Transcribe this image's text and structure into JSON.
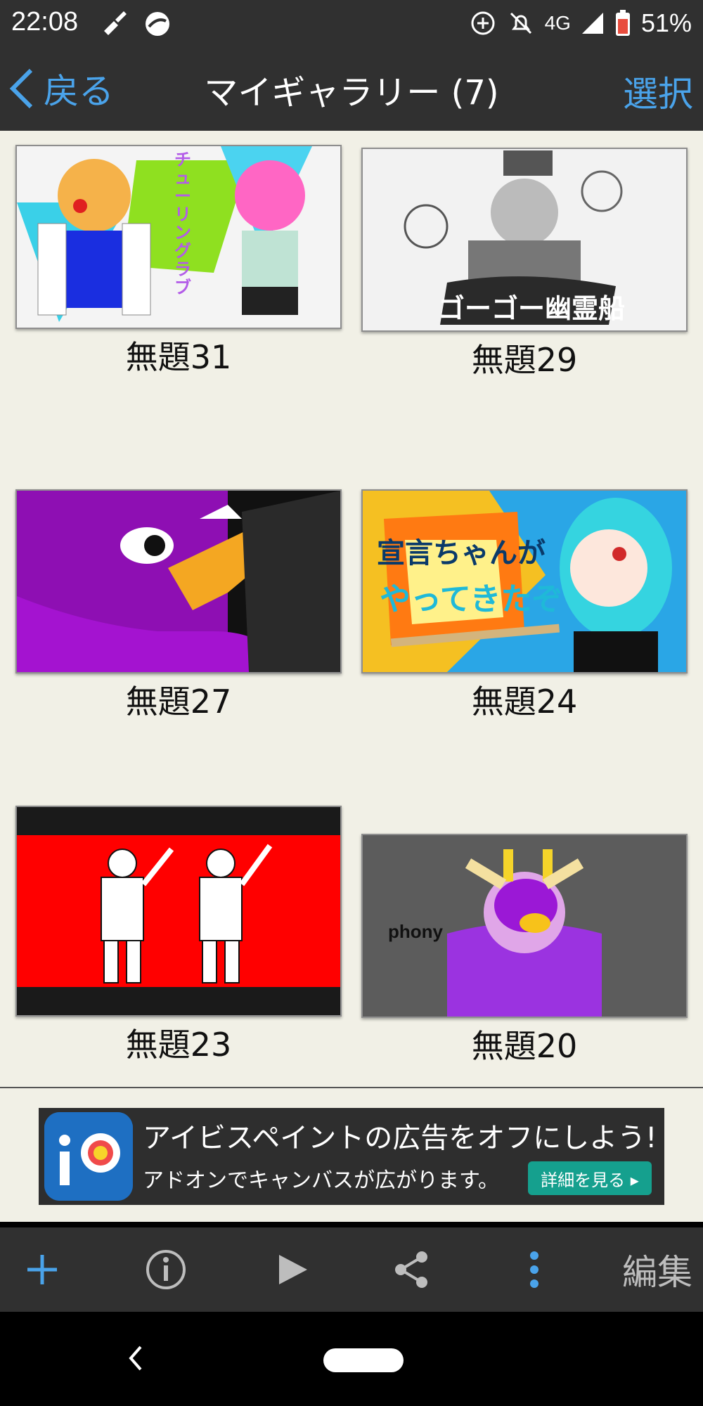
{
  "status_bar": {
    "time": "22:08",
    "network": "4G",
    "battery": "51%",
    "icons": [
      "broom-icon",
      "round-app-icon",
      "data-saver-icon",
      "bell-off-icon",
      "signal-icon",
      "battery-icon"
    ]
  },
  "app_bar": {
    "back_label": "戻る",
    "title": "マイギャラリー (7)",
    "select_label": "選択"
  },
  "gallery": {
    "items": [
      {
        "title": "無題31"
      },
      {
        "title": "無題29"
      },
      {
        "title": "無題27"
      },
      {
        "title": "無題24"
      },
      {
        "title": "無題23"
      },
      {
        "title": "無題20"
      }
    ]
  },
  "artwork_text": {
    "thumb1_vertical": "チューリングラブ",
    "thumb2_banner": "ゴーゴー幽霊船",
    "thumb4_line1": "宣言ちゃんが",
    "thumb4_line2": "やってきたぞ",
    "thumb6_word": "phony"
  },
  "ad": {
    "line1": "アイビスペイントの広告をオフにしよう!",
    "line2": "アドオンでキャンバスが広がります。",
    "button": "詳細を見る ▸"
  },
  "toolbar": {
    "edit_label": "編集",
    "accent": "#4aa3ea",
    "icons": [
      "plus-icon",
      "info-icon",
      "play-icon",
      "share-icon",
      "more-vertical-icon"
    ]
  },
  "colors": {
    "bar": "#303030",
    "background": "#f1f0e6",
    "accent": "#4aa3ea",
    "ad_button": "#15a08e"
  }
}
